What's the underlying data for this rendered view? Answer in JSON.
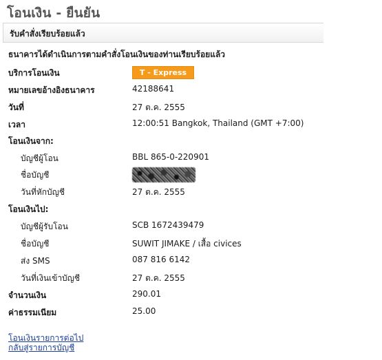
{
  "page": {
    "title": "โอนเงิน - ยืนยัน",
    "status": "รับคำสั่งเรียบร้อยแล้ว",
    "confirmation": "ธนาคารได้ดำเนินการตามคำสั่งโอนเงินของท่านเรียบร้อยแล้ว"
  },
  "details": {
    "service": {
      "label": "บริการโอนเงิน",
      "value": "T - Express"
    },
    "reference": {
      "label": "หมายเลขอ้างอิงธนาคาร",
      "value": "42188641"
    },
    "date": {
      "label": "วันที่",
      "value": "27 ต.ค. 2555"
    },
    "time": {
      "label": "เวลา",
      "value": "12:00:51 Bangkok, Thailand (GMT +7:00)"
    }
  },
  "from": {
    "heading": "โอนเงินจาก:",
    "account": {
      "label": "บัญชีผู้โอน",
      "value": "BBL 865-0-220901"
    },
    "name": {
      "label": "ชื่อบัญชี"
    },
    "debit_date": {
      "label": "วันที่หักบัญชี",
      "value": "27 ต.ค. 2555"
    }
  },
  "to": {
    "heading": "โอนเงินไป:",
    "account": {
      "label": "บัญชีผู้รับโอน",
      "value": "SCB 1672439479"
    },
    "name": {
      "label": "ชื่อบัญชี",
      "value": "SUWIT JIMAKE / เสื้อ civices"
    },
    "sms": {
      "label": "ส่ง SMS",
      "value": "087 816 6142"
    },
    "credit_date": {
      "label": "วันที่เงินเข้าบัญชี",
      "value": "27 ต.ค. 2555"
    }
  },
  "amounts": {
    "amount": {
      "label": "จำนวนเงิน",
      "value": "290.01"
    },
    "fee": {
      "label": "ค่าธรรมเนียม",
      "value": "25.00"
    }
  },
  "links": {
    "next_transfer": "โอนเงินรายการต่อไป",
    "back_to_accounts": "กลับสู่รายการบัญชี"
  },
  "colors": {
    "badge_bg": "#f59a1b",
    "link": "#1a3d99",
    "title": "#555555"
  }
}
